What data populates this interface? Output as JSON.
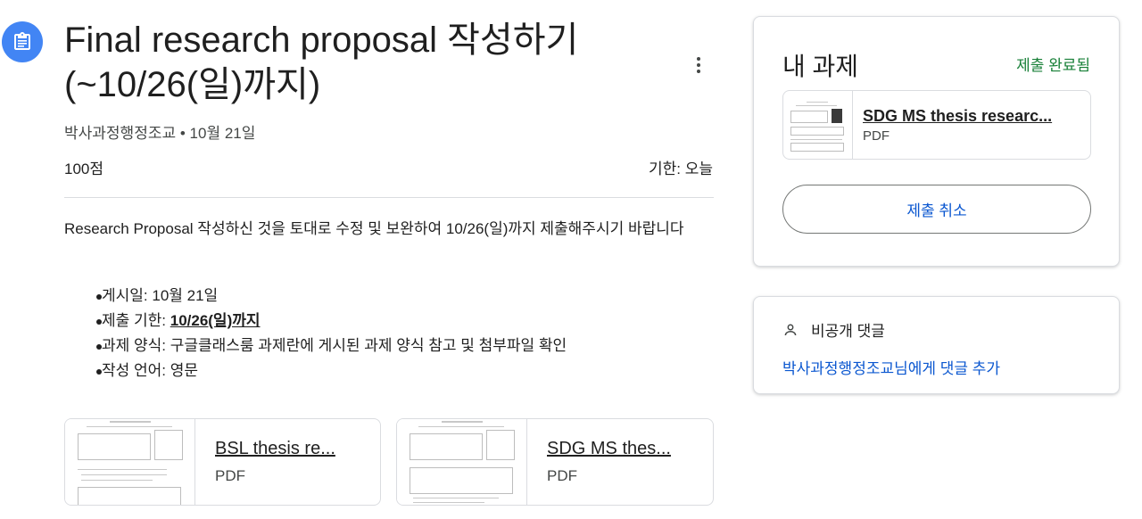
{
  "assignment": {
    "title_line1": "Final research proposal 작성하기",
    "title_line2": "(~10/26(일)까지)",
    "author": "박사과정행정조교",
    "separator": "•",
    "date": "10월 21일",
    "points": "100점",
    "due": "기한: 오늘",
    "description": "Research Proposal 작성하신 것을 토대로 수정 및 보완하여 10/26(일)까지 제출해주시기 바랍니다",
    "bullets": [
      {
        "text": "게시일: 10월 21일"
      },
      {
        "prefix": "제출 기한: ",
        "link": "10/26(일)까지"
      },
      {
        "text": "과제 양식: 구글클래스룸 과제란에 게시된 과제 양식 참고 및 첨부파일 확인"
      },
      {
        "text": "작성 언어: 영문"
      }
    ],
    "attachments": [
      {
        "name": "BSL thesis re...",
        "type": "PDF"
      },
      {
        "name": "SDG MS thes...",
        "type": "PDF"
      }
    ]
  },
  "your_work": {
    "title": "내 과제",
    "status": "제출 완료됨",
    "attachment": {
      "name": "SDG MS thesis researc...",
      "type": "PDF"
    },
    "unsubmit_label": "제출 취소"
  },
  "private_comments": {
    "heading": "비공개 댓글",
    "add_link": "박사과정행정조교님에게 댓글 추가"
  },
  "colors": {
    "accent_blue": "#0b57d0",
    "icon_blue": "#4285f4",
    "status_green": "#188038"
  },
  "icons": [
    "assignment-icon",
    "more-vert-icon",
    "person-icon"
  ]
}
